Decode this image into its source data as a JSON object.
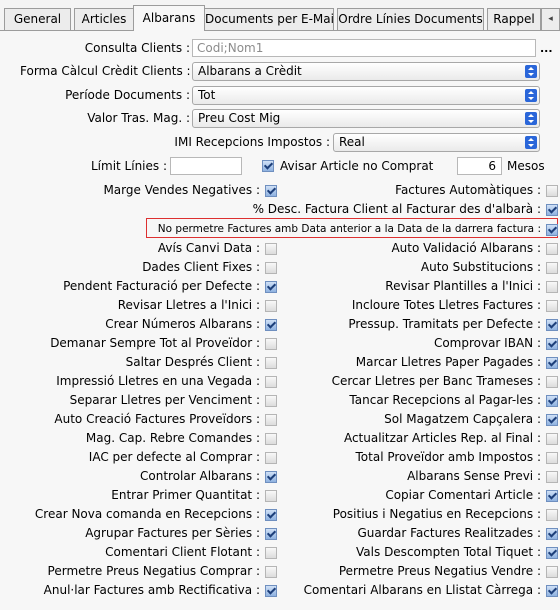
{
  "tabs": [
    "General",
    "Articles",
    "Albarans",
    "Documents per E-Mail",
    "Ordre Línies Documents",
    "Rappel"
  ],
  "active_tab": "Albarans",
  "form": {
    "consulta_clients": {
      "label": "Consulta Clients :",
      "placeholder": "Codi;Nom1",
      "button": "..."
    },
    "forma_calcul_credit": {
      "label": "Forma Càlcul Crèdit Clients :",
      "value": "Albarans a Crèdit"
    },
    "periode_documents": {
      "label": "Període Documents :",
      "value": "Tot"
    },
    "valor_tras_mag": {
      "label": "Valor Tras. Mag. :",
      "value": "Preu Cost Mig"
    },
    "iml_recepcions": {
      "label": "IMI Recepcions Impostos :",
      "value": "Real"
    },
    "limit_linies": {
      "label": "Límit Línies :",
      "value": ""
    },
    "avisar_article": {
      "label": "Avisar Article no Comprat",
      "checked": true,
      "months": "6",
      "months_label": "Mesos"
    }
  },
  "options": {
    "left": [
      {
        "label": "Marge Vendes Negatives :",
        "checked": true
      },
      {
        "label": "Avís Canvi Data :",
        "checked": false
      },
      {
        "label": "Dades Client Fixes :",
        "checked": false
      },
      {
        "label": "Pendent Facturació per Defecte :",
        "checked": true
      },
      {
        "label": "Revisar Lletres a l'Inici :",
        "checked": false
      },
      {
        "label": "Crear Números Albarans :",
        "checked": true
      },
      {
        "label": "Demanar Sempre Tot al Proveïdor :",
        "checked": false
      },
      {
        "label": "Saltar Després Client :",
        "checked": false
      },
      {
        "label": "Impressió Lletres en una Vegada :",
        "checked": false
      },
      {
        "label": "Separar Lletres per Venciment :",
        "checked": false
      },
      {
        "label": "Auto Creació Factures Proveïdors :",
        "checked": false
      },
      {
        "label": "Mag. Cap. Rebre Comandes :",
        "checked": false
      },
      {
        "label": "IAC per defecte al Comprar :",
        "checked": false
      },
      {
        "label": "Controlar Albarans :",
        "checked": true
      },
      {
        "label": "Entrar Primer Quantitat :",
        "checked": false
      },
      {
        "label": "Crear Nova comanda en Recepcions :",
        "checked": true
      },
      {
        "label": "Agrupar Factures per Sèries :",
        "checked": true
      },
      {
        "label": "Comentari Client Flotant :",
        "checked": false
      },
      {
        "label": "Permetre Preus Negatius Comprar :",
        "checked": false
      },
      {
        "label": "Anul·lar Factures amb Rectificativa :",
        "checked": true
      }
    ],
    "right": [
      {
        "label": "Factures Automàtiques :",
        "checked": false
      },
      {
        "label": "% Desc. Factura Client al Facturar des d'albarà :",
        "checked": true
      },
      {
        "label": "No permetre Factures amb Data anterior a la Data de la darrera factura :",
        "checked": true
      },
      {
        "label": "Auto Validació Albarans :",
        "checked": false
      },
      {
        "label": "Auto Substitucions :",
        "checked": false
      },
      {
        "label": "Revisar Plantilles a l'Inici :",
        "checked": false
      },
      {
        "label": "Incloure Totes Lletres Factures :",
        "checked": false
      },
      {
        "label": "Pressup. Tramitats per Defecte :",
        "checked": true
      },
      {
        "label": "Comprovar IBAN :",
        "checked": true
      },
      {
        "label": "Marcar Lletres Paper Pagades :",
        "checked": true
      },
      {
        "label": "Cercar Lletres per Banc Trameses :",
        "checked": false
      },
      {
        "label": "Tancar Recepcions al Pagar-les :",
        "checked": true
      },
      {
        "label": "Sol Magatzem Capçalera :",
        "checked": true
      },
      {
        "label": "Actualitzar Articles Rep. al Final :",
        "checked": false
      },
      {
        "label": "Total Proveïdor amb Impostos :",
        "checked": false
      },
      {
        "label": "Albarans Sense Previ :",
        "checked": false
      },
      {
        "label": "Copiar Comentari Article :",
        "checked": true
      },
      {
        "label": "Positius i Negatius en Recepcions :",
        "checked": false
      },
      {
        "label": "Guardar Factures Realitzades :",
        "checked": true
      },
      {
        "label": "Vals Descompten Total Tiquet :",
        "checked": true
      },
      {
        "label": "Permetre Preus Negatius Vendre :",
        "checked": false
      },
      {
        "label": "Comentari Albarans en Llistat Càrrega :",
        "checked": true
      }
    ]
  }
}
